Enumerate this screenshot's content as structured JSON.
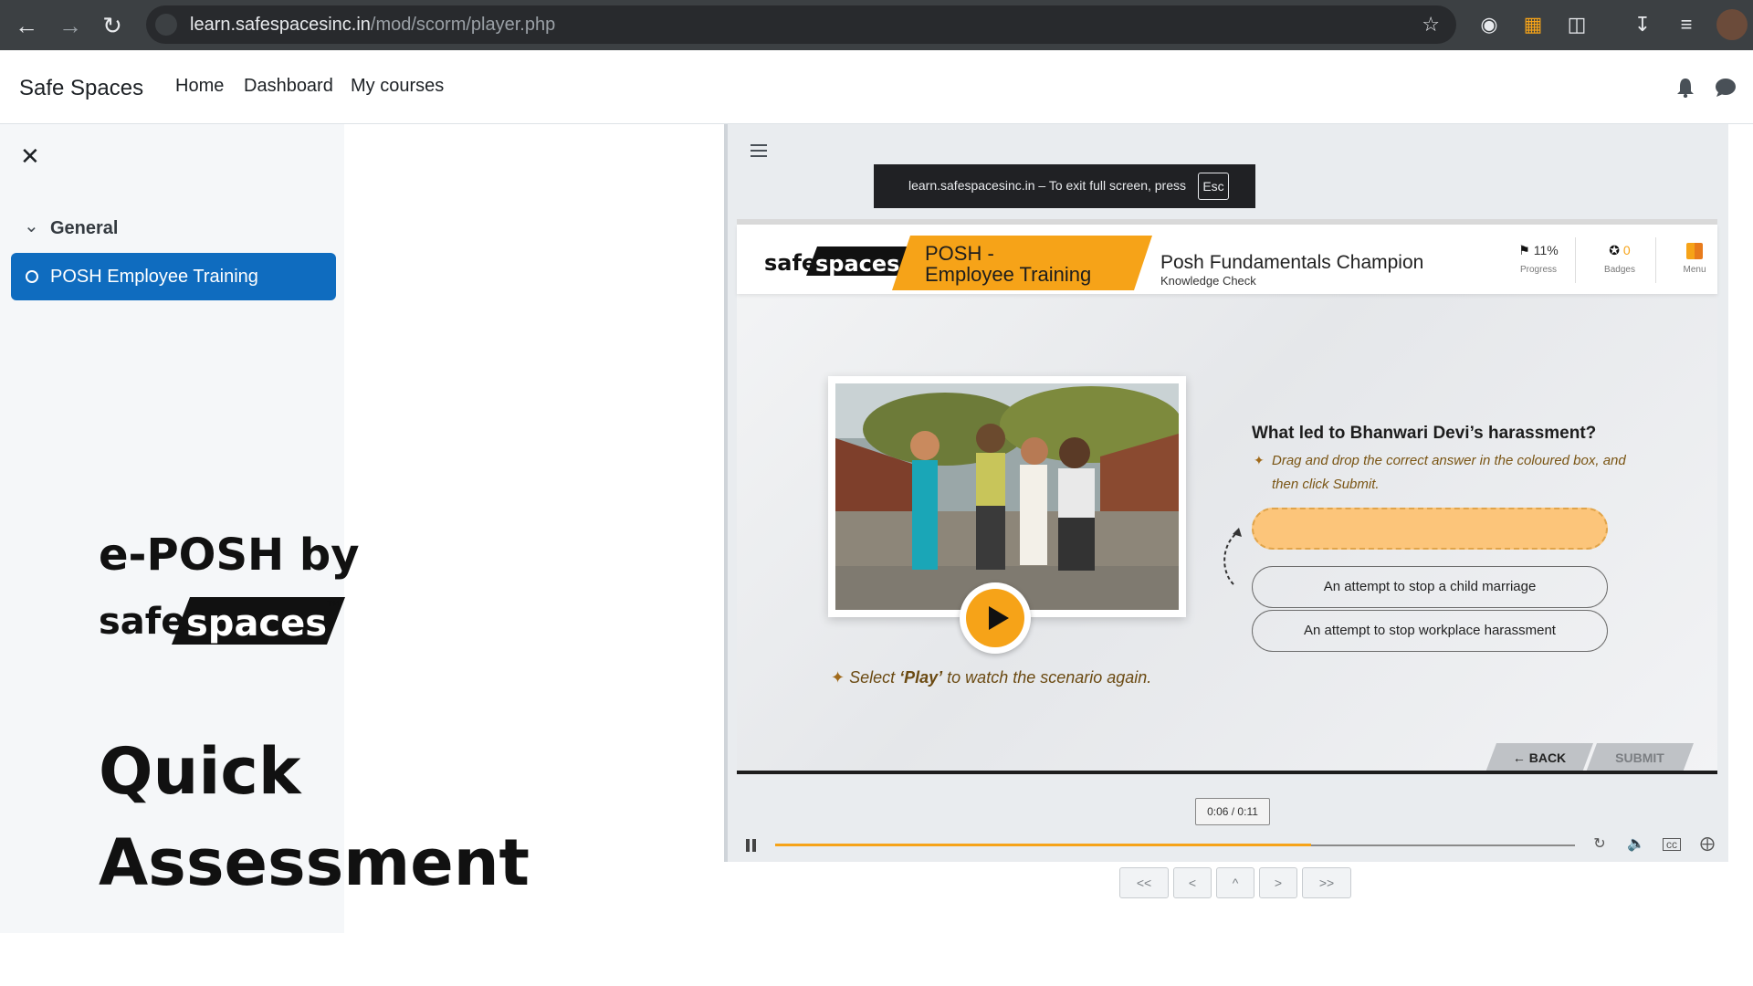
{
  "browser": {
    "url_host": "learn.safespacesinc.in",
    "url_path": "/mod/scorm/player.php",
    "back_icon": "arrow-back-icon",
    "forward_icon": "arrow-forward-icon",
    "reload_icon": "reload-icon"
  },
  "site": {
    "brand": "Safe Spaces",
    "nav": [
      "Home",
      "Dashboard",
      "My courses"
    ]
  },
  "drawer": {
    "section_title": "General",
    "active_item": "POSH Employee Training"
  },
  "promo": {
    "line1": "e-POSH by",
    "logo_text": "safespaces",
    "line2": "Quick",
    "line3": "Assessment"
  },
  "fullscreen_toast": {
    "text": "learn.safespacesinc.in – To exit full screen, press",
    "key": "Esc"
  },
  "slide": {
    "logo": "safespaces",
    "ribbon_line1": "POSH -",
    "ribbon_line2": "Employee Training",
    "course_title": "Posh Fundamentals Champion",
    "course_subtitle": "Knowledge Check",
    "progress_value": "11%",
    "progress_label": "Progress",
    "badges_value": "0",
    "badges_label": "Badges",
    "menu_label": "Menu",
    "play_hint_prefix": "Select ",
    "play_hint_bold": "‘Play’",
    "play_hint_suffix": " to  watch the scenario again.",
    "question": "What led to Bhanwari Devi’s harassment?",
    "instruction": "Drag and drop the correct answer in the coloured box, and then click Submit.",
    "answers": [
      "An attempt to stop a child marriage",
      "An attempt to stop workplace harassment"
    ],
    "back_label": "← BACK",
    "submit_label": "SUBMIT"
  },
  "player": {
    "time": "0:06 / 0:11",
    "progress_fraction": 0.67
  },
  "nav_buttons": [
    "<<",
    "<",
    "^",
    ">",
    ">>"
  ],
  "colors": {
    "accent_orange": "#f6a318",
    "active_blue": "#0f6cbf"
  }
}
